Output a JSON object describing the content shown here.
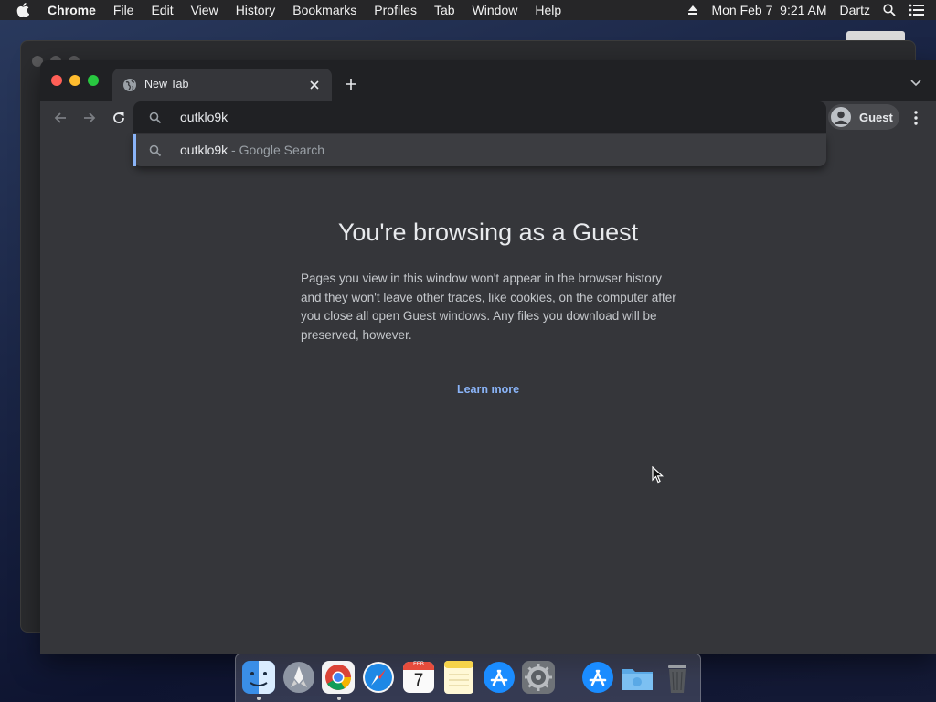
{
  "menubar": {
    "app_name": "Chrome",
    "items": [
      "File",
      "Edit",
      "View",
      "History",
      "Bookmarks",
      "Profiles",
      "Tab",
      "Window",
      "Help"
    ],
    "clock": "Mon Feb 7  9:21 AM",
    "user": "Dartz",
    "icons": [
      "apple-icon",
      "eject-icon",
      "spotlight-search-icon",
      "control-center-icon"
    ]
  },
  "browser": {
    "tab": {
      "title": "New Tab",
      "favicon": "globe-icon"
    },
    "omnibox": {
      "value": "outklo9k"
    },
    "profile": {
      "label": "Guest"
    },
    "suggestions": [
      {
        "query": "outklo9k",
        "suffix": " - Google Search"
      }
    ],
    "page": {
      "heading": "You're browsing as a Guest",
      "body": "Pages you view in this window won't appear in the browser history and they won't leave other traces, like cookies, on the computer after you close all open Guest windows. Any files you download will be preserved, however.",
      "link": "Learn more"
    }
  },
  "calendar_icon": {
    "month": "FEB",
    "day": "7"
  },
  "colors": {
    "link": "#8ab4f8",
    "selection_bar": "#8ab4f8",
    "window_bg": "#35363a",
    "tabstrip_bg": "#202124"
  },
  "dock": {
    "apps": [
      "Finder",
      "Launchpad",
      "Google Chrome",
      "Safari",
      "Calendar",
      "Notes",
      "App Store",
      "System Preferences",
      "App Store",
      "Downloads",
      "Trash"
    ]
  }
}
